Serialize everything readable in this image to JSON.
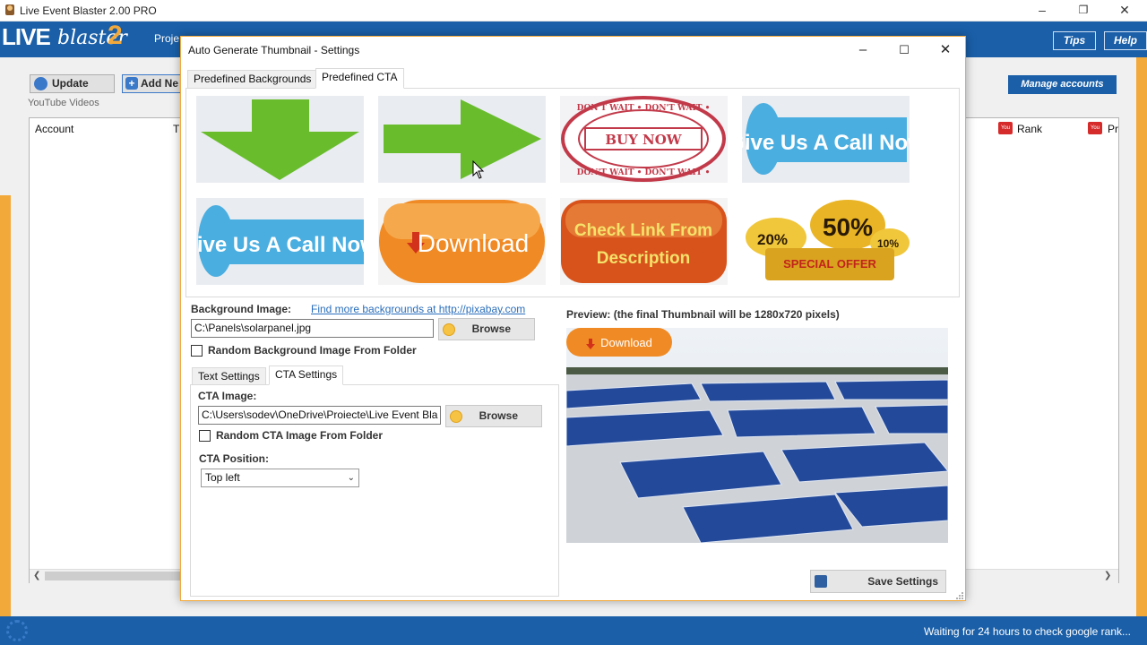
{
  "main_window": {
    "title": "Live Event Blaster 2.00 PRO",
    "logo": {
      "live": "LIVE",
      "blaster": "blaster",
      "two": "2"
    },
    "project_tab": "Proje",
    "tips": "Tips",
    "help": "Help",
    "update_button": "Update",
    "add_new_button": "Add Ne",
    "manage_accounts": "Manage accounts",
    "youtube_group": "YouTube Videos",
    "columns": {
      "account": "Account",
      "t": "T",
      "rank": "Rank",
      "pr": "Pr"
    },
    "status": "Waiting for 24 hours to check google rank..."
  },
  "dialog": {
    "title": "Auto Generate Thumbnail - Settings",
    "tabs": [
      {
        "label": "Predefined Backgrounds",
        "active": false
      },
      {
        "label": "Predefined CTA",
        "active": true
      }
    ],
    "cta_items": [
      {
        "name": "green-down-arrow",
        "text": ""
      },
      {
        "name": "green-right-arrow",
        "text": ""
      },
      {
        "name": "buy-now-stamp",
        "text": "BUY NOW",
        "ring": "DON'T WAIT • DON'T WAIT •"
      },
      {
        "name": "give-us-a-call-now",
        "text": "Give Us A Call Now!"
      },
      {
        "name": "give-us-a-call-now-2",
        "text": "Give Us A Call Now!"
      },
      {
        "name": "download-button",
        "text": "Download"
      },
      {
        "name": "check-link-from-description",
        "line1": "Check Link From",
        "line2": "Description"
      },
      {
        "name": "special-offer",
        "p50": "50%",
        "p20": "20%",
        "p10": "10%",
        "text": "SPECIAL OFFER"
      }
    ],
    "background_image_label": "Background Image:",
    "find_more_link": "Find more backgrounds at http://pixabay.com",
    "background_path": "C:\\Panels\\solarpanel.jpg",
    "browse": "Browse",
    "random_bg_label": "Random Background Image From Folder",
    "subtabs": [
      {
        "label": "Text Settings",
        "active": false
      },
      {
        "label": "CTA Settings",
        "active": true
      }
    ],
    "cta_image_label": "CTA Image:",
    "cta_path": "C:\\Users\\sodev\\OneDrive\\Proiecte\\Live Event Bla",
    "random_cta_label": "Random CTA Image From Folder",
    "cta_position_label": "CTA Position:",
    "cta_position_value": "Top left",
    "preview_label": "Preview: (the final Thumbnail will be 1280x720 pixels)",
    "preview_cta_text": "Download",
    "save_settings": "Save Settings"
  },
  "colors": {
    "brand_blue": "#1a5fa8",
    "accent_orange": "#f3a93a",
    "arrow_green": "#69bd2c",
    "download_orange": "#f08a24",
    "stamp_red": "#c23a4a",
    "call_blue": "#4aaee0"
  }
}
